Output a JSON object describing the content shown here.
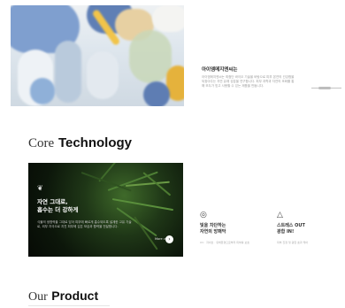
{
  "hero": {
    "title": "아이엠메지엔씨는",
    "description": "아이엠메지엔씨는 최첨단 바이오 기술을 바탕으로 피부 본연의 건강함을 되찾아주는 자연 유래 성분을 연구합니다. 피부 과학과 자연의 조화를 통해 모두가 믿고 사용할 수 있는 제품을 만듭니다."
  },
  "core_technology": {
    "heading_serif": "Core",
    "heading_bold": "Technology",
    "card": {
      "icon": "leaf-icon",
      "title": "자연 그대로,\n흡수는 더 강하게",
      "description": "식물의 생명력을 그대로 담아 피부에 빠르게 흡수되도록 설계한 고유 기술로, 외부 자극으로 지친 피부에 깊은 보습과 활력을 전달합니다.",
      "more_label": "More view",
      "more_icon": "arrow-right-icon"
    },
    "features": [
      {
        "icon": "shield-icon",
        "title": "빛을 차단하는\n자연의 방패막",
        "description": "UV · 자외선 · 유해환경으로부터 피부를 보호"
      },
      {
        "icon": "flask-icon",
        "title": "스트레스 OUT\n광합 IN!",
        "description": "피부 진정 및 광합 효과 케어"
      }
    ]
  },
  "our_product": {
    "heading_serif": "Our",
    "heading_bold": "Product"
  }
}
